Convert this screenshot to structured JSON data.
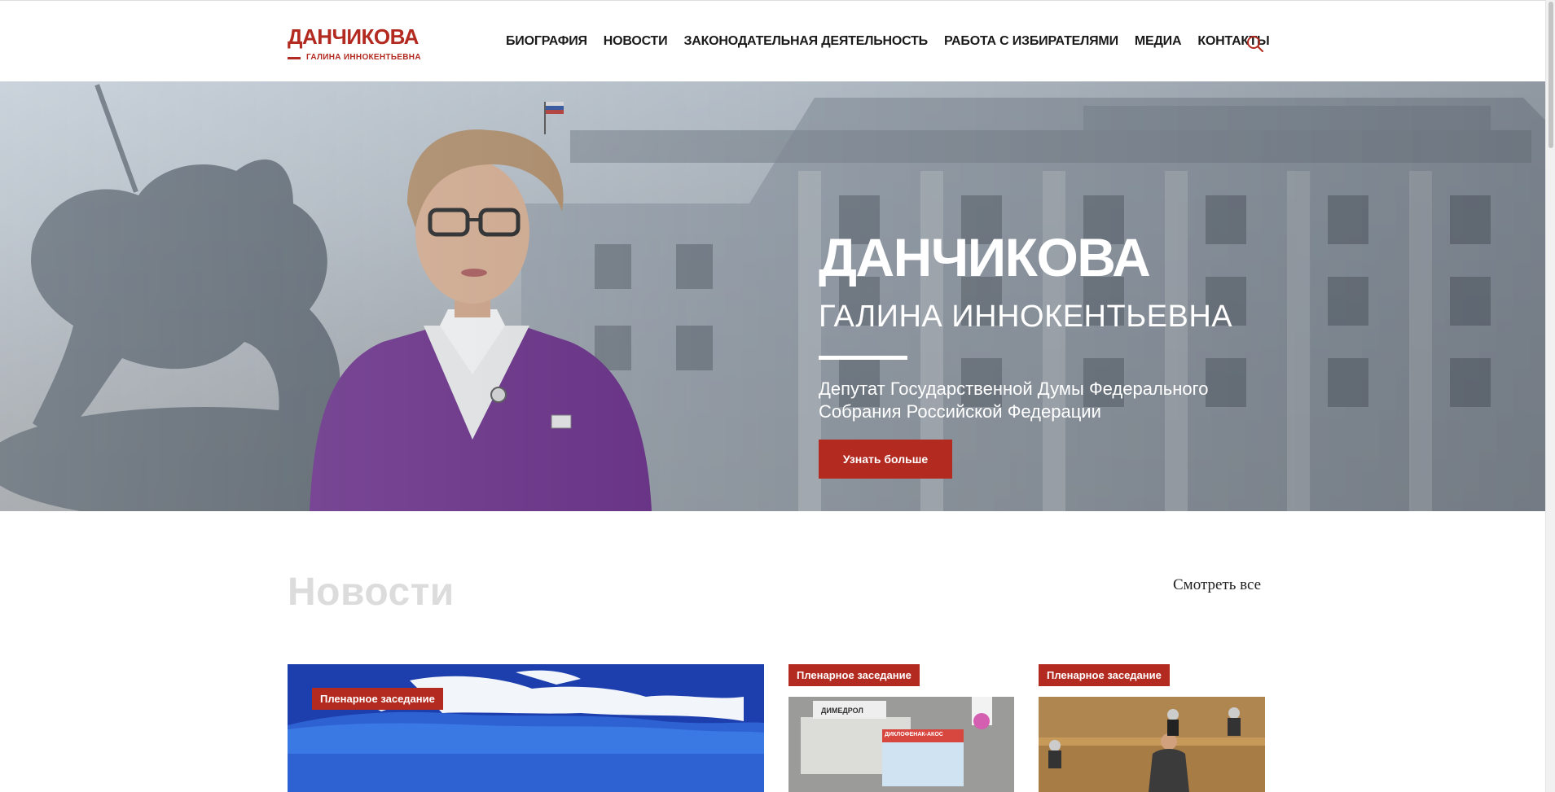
{
  "header": {
    "logo_title": "ДАНЧИКОВА",
    "logo_subtitle": "ГАЛИНА ИННОКЕНТЬЕВНА",
    "nav": [
      "БИОГРАФИЯ",
      "НОВОСТИ",
      "ЗАКОНОДАТЕЛЬНАЯ ДЕЯТЕЛЬНОСТЬ",
      "РАБОТА С ИЗБИРАТЕЛЯМИ",
      "МЕДИА",
      "КОНТАКТЫ"
    ],
    "search_icon": "search-icon"
  },
  "hero": {
    "title": "ДАНЧИКОВА",
    "subtitle": "ГАЛИНА ИННОКЕНТЬЕВНА",
    "description": "Депутат Государственной Думы Федерального Собрания Российской Федерации",
    "button_label": "Узнать больше"
  },
  "news": {
    "title": "Новости",
    "see_all": "Смотреть все",
    "cards": [
      {
        "tag": "Пленарное заседание"
      },
      {
        "tag": "Пленарное заседание",
        "box_label": "ДИМЕДРОЛ",
        "box_label_2": "ДИКЛОФЕНАК-АКОС"
      },
      {
        "tag": "Пленарное заседание"
      }
    ]
  },
  "colors": {
    "accent": "#b32a20",
    "nav_text": "#1a1a1a",
    "section_title": "#dcdcdc"
  }
}
